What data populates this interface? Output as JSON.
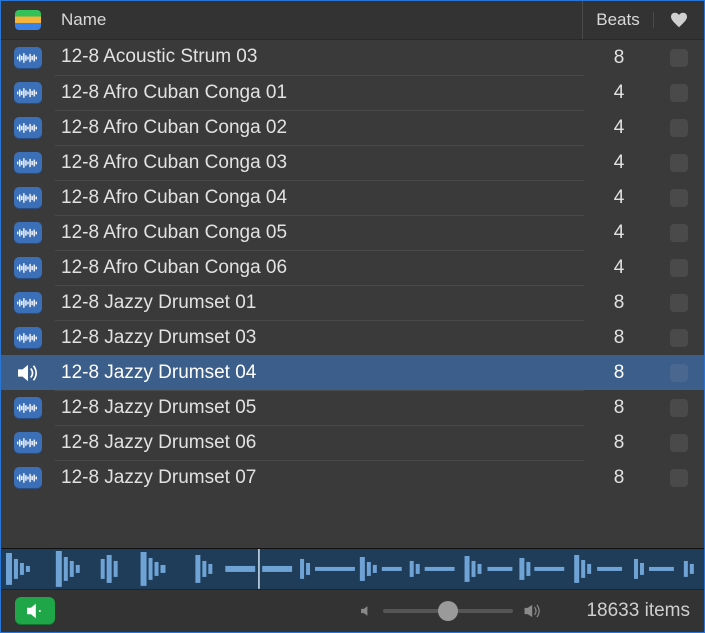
{
  "header": {
    "name_label": "Name",
    "beats_label": "Beats"
  },
  "rows": [
    {
      "name": "12-8 Acoustic Strum 03",
      "beats": "8",
      "selected": false,
      "playing": false
    },
    {
      "name": "12-8 Afro Cuban Conga 01",
      "beats": "4",
      "selected": false,
      "playing": false
    },
    {
      "name": "12-8 Afro Cuban Conga 02",
      "beats": "4",
      "selected": false,
      "playing": false
    },
    {
      "name": "12-8 Afro Cuban Conga 03",
      "beats": "4",
      "selected": false,
      "playing": false
    },
    {
      "name": "12-8 Afro Cuban Conga 04",
      "beats": "4",
      "selected": false,
      "playing": false
    },
    {
      "name": "12-8 Afro Cuban Conga 05",
      "beats": "4",
      "selected": false,
      "playing": false
    },
    {
      "name": "12-8 Afro Cuban Conga 06",
      "beats": "4",
      "selected": false,
      "playing": false
    },
    {
      "name": "12-8 Jazzy Drumset 01",
      "beats": "8",
      "selected": false,
      "playing": false
    },
    {
      "name": "12-8 Jazzy Drumset 03",
      "beats": "8",
      "selected": false,
      "playing": false
    },
    {
      "name": "12-8 Jazzy Drumset 04",
      "beats": "8",
      "selected": true,
      "playing": true
    },
    {
      "name": "12-8 Jazzy Drumset 05",
      "beats": "8",
      "selected": false,
      "playing": false
    },
    {
      "name": "12-8 Jazzy Drumset 06",
      "beats": "8",
      "selected": false,
      "playing": false
    },
    {
      "name": "12-8 Jazzy Drumset 07",
      "beats": "8",
      "selected": false,
      "playing": false
    }
  ],
  "footer": {
    "item_count": "18633 items",
    "volume_pct": 50
  }
}
